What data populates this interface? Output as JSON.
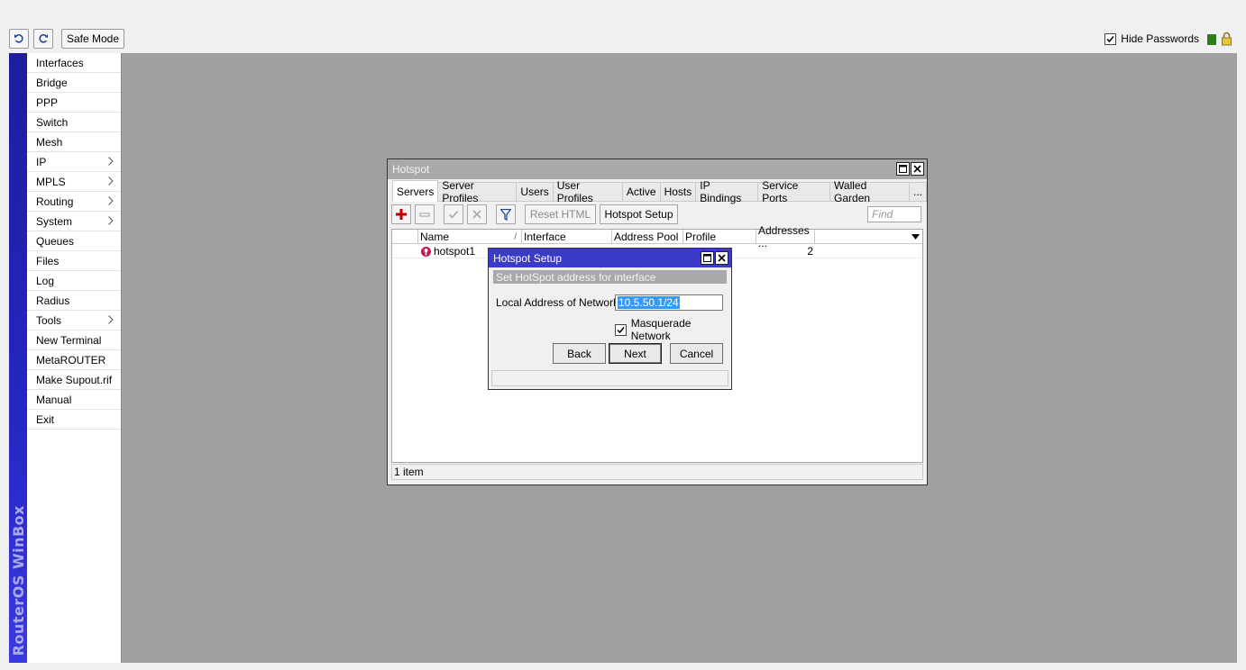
{
  "toolbar": {
    "undo_icon": "undo-icon",
    "redo_icon": "redo-icon",
    "safe_mode": "Safe Mode",
    "hide_passwords": "Hide Passwords",
    "hide_passwords_checked": true
  },
  "brand": "RouterOS WinBox",
  "menu": {
    "items": [
      {
        "label": "Interfaces",
        "submenu": false
      },
      {
        "label": "Bridge",
        "submenu": false
      },
      {
        "label": "PPP",
        "submenu": false
      },
      {
        "label": "Switch",
        "submenu": false
      },
      {
        "label": "Mesh",
        "submenu": false
      },
      {
        "label": "IP",
        "submenu": true
      },
      {
        "label": "MPLS",
        "submenu": true
      },
      {
        "label": "Routing",
        "submenu": true
      },
      {
        "label": "System",
        "submenu": true
      },
      {
        "label": "Queues",
        "submenu": false
      },
      {
        "label": "Files",
        "submenu": false
      },
      {
        "label": "Log",
        "submenu": false
      },
      {
        "label": "Radius",
        "submenu": false
      },
      {
        "label": "Tools",
        "submenu": true
      },
      {
        "label": "New Terminal",
        "submenu": false
      },
      {
        "label": "MetaROUTER",
        "submenu": false
      },
      {
        "label": "Make Supout.rif",
        "submenu": false
      },
      {
        "label": "Manual",
        "submenu": false
      },
      {
        "label": "Exit",
        "submenu": false
      }
    ]
  },
  "hotspot_window": {
    "title": "Hotspot",
    "tabs": [
      "Servers",
      "Server Profiles",
      "Users",
      "User Profiles",
      "Active",
      "Hosts",
      "IP Bindings",
      "Service Ports",
      "Walled Garden",
      "..."
    ],
    "active_tab": "Servers",
    "buttons": {
      "reset_html": "Reset HTML",
      "hotspot_setup": "Hotspot Setup"
    },
    "find_placeholder": "Find",
    "columns": [
      "Name",
      "Interface",
      "Address Pool",
      "Profile",
      "Addresses ..."
    ],
    "sort_marker": "/",
    "rows": [
      {
        "name": "hotspot1",
        "interface": "",
        "address_pool": "",
        "profile": "",
        "addresses": "2"
      }
    ],
    "status": "1 item"
  },
  "setup_dialog": {
    "title": "Hotspot Setup",
    "subtitle": "Set HotSpot address for interface",
    "local_address_label": "Local Address of Network:",
    "local_address_value": "10.5.50.1/24",
    "masquerade_label": "Masquerade Network",
    "masquerade_checked": true,
    "buttons": {
      "back": "Back",
      "next": "Next",
      "cancel": "Cancel"
    }
  },
  "colors": {
    "workspace": "#a0a0a0",
    "dialog_title": "#3b3bc8",
    "brand_bar": "#2626c4",
    "add_icon": "#c00000"
  }
}
